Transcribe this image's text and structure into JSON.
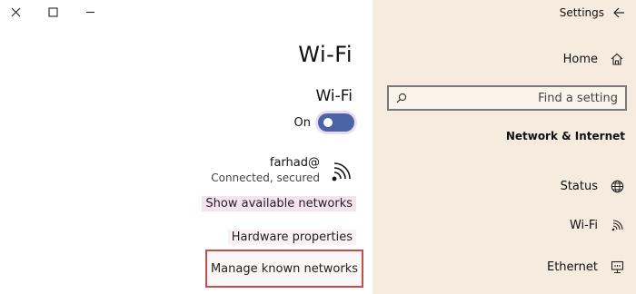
{
  "window": {
    "close_glyph": "×"
  },
  "content": {
    "page_title": "Wi-Fi",
    "section_title": "Wi-Fi",
    "toggle": {
      "state_label": "On",
      "on": true,
      "color": "#4a63a7"
    },
    "network": {
      "name": "farhad@",
      "status": "Connected, secured"
    },
    "links": {
      "show_available": "Show available networks",
      "hardware_properties": "Hardware properties",
      "manage_known": "Manage known networks"
    },
    "highlight_color": "#c0504d"
  },
  "sidebar": {
    "header_title": "Settings",
    "home_label": "Home",
    "search_placeholder": "Find a setting",
    "section_title": "Network & Internet",
    "items": [
      {
        "label": "Status",
        "icon": "globe-icon"
      },
      {
        "label": "Wi-Fi",
        "icon": "wifi-icon"
      },
      {
        "label": "Ethernet",
        "icon": "ethernet-icon"
      }
    ],
    "background": "#f5ebde"
  }
}
